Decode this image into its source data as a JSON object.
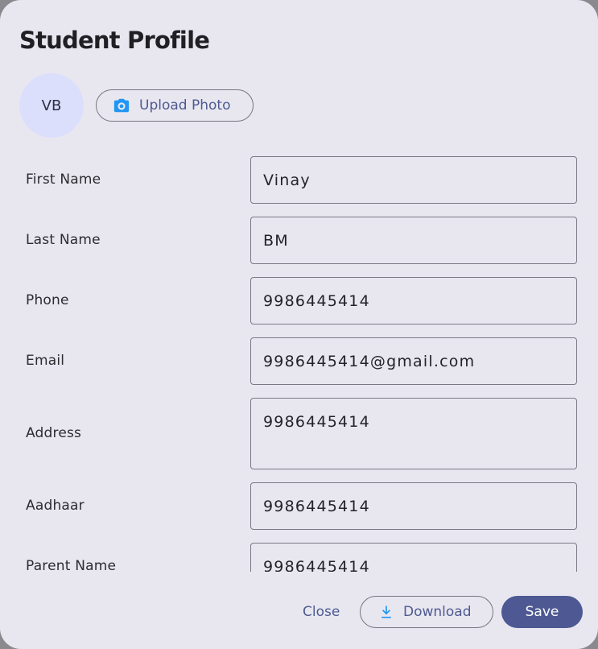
{
  "dialog": {
    "title": "Student Profile"
  },
  "avatar": {
    "initials": "VB",
    "bg_color": "#dcdffb"
  },
  "upload": {
    "label": "Upload Photo",
    "icon": "camera-icon",
    "icon_color": "#2196f3"
  },
  "fields": {
    "first_name": {
      "label": "First Name",
      "value": "Vinay"
    },
    "last_name": {
      "label": "Last Name",
      "value": "BM"
    },
    "phone": {
      "label": "Phone",
      "value": "9986445414"
    },
    "email": {
      "label": "Email",
      "value": "9986445414@gmail.com"
    },
    "address": {
      "label": "Address",
      "value": "9986445414"
    },
    "aadhaar": {
      "label": "Aadhaar",
      "value": "9986445414"
    },
    "parent_name": {
      "label": "Parent Name",
      "value": "9986445414"
    }
  },
  "footer": {
    "close_label": "Close",
    "download_label": "Download",
    "download_icon": "download-icon",
    "save_label": "Save"
  },
  "colors": {
    "accent": "#4e5993",
    "surface": "#e8e7f0",
    "icon_blue": "#2196f3"
  }
}
